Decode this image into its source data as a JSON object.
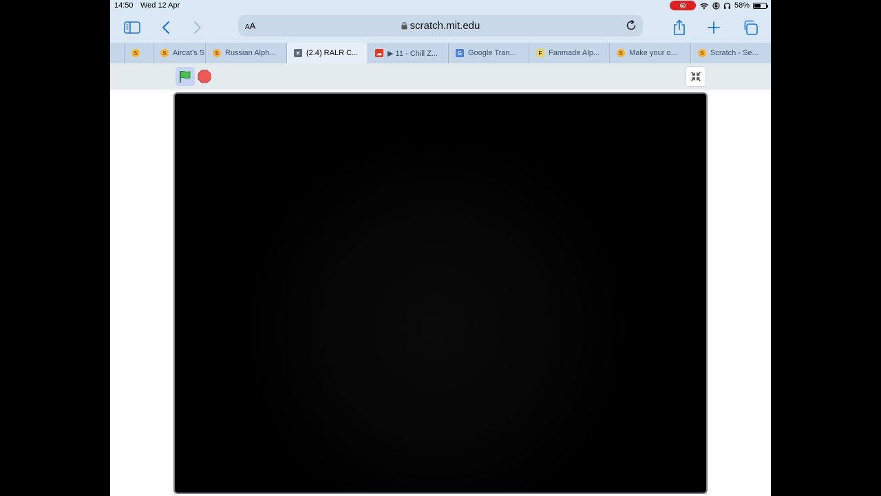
{
  "status": {
    "time": "14:50",
    "date": "Wed 12 Apr",
    "battery_text": "58%",
    "battery_level": 0.58
  },
  "browser": {
    "aa_small": "A",
    "aa_large": "A",
    "url": "scratch.mit.edu",
    "icons": [
      "sidebar-icon",
      "back-icon",
      "forward-icon",
      "lock-icon",
      "reload-icon",
      "share-icon",
      "plus-icon",
      "tabs-icon"
    ]
  },
  "tabs": [
    {
      "label": "",
      "icon": "scratch-icon"
    },
    {
      "label": "Aircat's S",
      "icon": "scratch-icon"
    },
    {
      "label": "Russian Alph...",
      "icon": "scratch-icon"
    },
    {
      "label": "(2.4) RALR C...",
      "icon": "x-icon",
      "active": true
    },
    {
      "label": "▶ 11 - Chill Z...",
      "icon": "soundcloud-icon"
    },
    {
      "label": "Google Tran...",
      "icon": "google-translate-icon"
    },
    {
      "label": "Fanmade Alp...",
      "icon": "fandom-icon"
    },
    {
      "label": "Make your o...",
      "icon": "scratch-icon"
    },
    {
      "label": "Scratch - Se...",
      "icon": "scratch-icon"
    }
  ],
  "colors": {
    "chrome_bg": "#dbe8f5",
    "tabstrip_bg": "#c5d6e9",
    "flag_green": "#4cbf56",
    "stop_red": "#ec5959",
    "stage_border": "#7b7f94"
  }
}
